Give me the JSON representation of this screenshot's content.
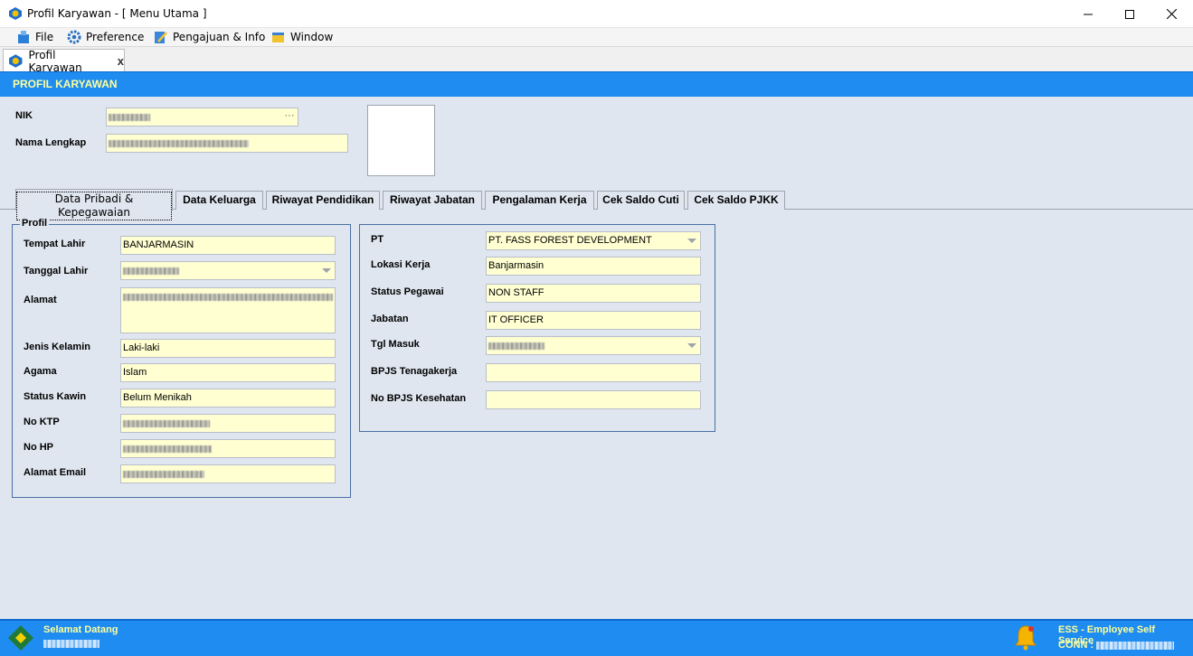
{
  "window": {
    "title": "Profil Karyawan - [ Menu Utama ]",
    "minimize_glyph": "—",
    "maximize_glyph": "☐",
    "close_glyph": "✕"
  },
  "menu": {
    "items": [
      {
        "label": "File",
        "icon": "file-icon"
      },
      {
        "label": "Preference",
        "icon": "gear-icon"
      },
      {
        "label": "Pengajuan & Info",
        "icon": "edit-document-icon"
      },
      {
        "label": "Window",
        "icon": "window-icon"
      }
    ]
  },
  "doc_tab": {
    "label": "Profil Karyawan",
    "close": "x"
  },
  "header": {
    "title": "PROFIL KARYAWAN"
  },
  "identity": {
    "nik_label": "NIK",
    "nik_value": "",
    "nik_browse": "···",
    "nama_label": "Nama Lengkap",
    "nama_value": ""
  },
  "subtabs": [
    "Data Pribadi & Kepegawaian",
    "Data Keluarga",
    "Riwayat Pendidikan",
    "Riwayat Jabatan",
    "Pengalaman Kerja",
    "Cek Saldo Cuti",
    "Cek Saldo PJKK"
  ],
  "profil": {
    "group_title": "Profil",
    "tempat_lahir": {
      "label": "Tempat Lahir",
      "value": "BANJARMASIN"
    },
    "tanggal_lahir": {
      "label": "Tanggal Lahir",
      "value": ""
    },
    "alamat": {
      "label": "Alamat",
      "value": ""
    },
    "jenis_kelamin": {
      "label": "Jenis Kelamin",
      "value": "Laki-laki"
    },
    "agama": {
      "label": "Agama",
      "value": "Islam"
    },
    "status_kawin": {
      "label": "Status Kawin",
      "value": "Belum Menikah"
    },
    "no_ktp": {
      "label": "No KTP",
      "value": ""
    },
    "no_hp": {
      "label": "No HP",
      "value": ""
    },
    "alamat_email": {
      "label": "Alamat Email",
      "value": ""
    }
  },
  "kepegawaian": {
    "pt": {
      "label": "PT",
      "value": "PT. FASS FOREST DEVELOPMENT"
    },
    "lokasi_kerja": {
      "label": "Lokasi Kerja",
      "value": "Banjarmasin"
    },
    "status_pegawai": {
      "label": "Status Pegawai",
      "value": "NON STAFF"
    },
    "jabatan": {
      "label": "Jabatan",
      "value": "IT OFFICER"
    },
    "tgl_masuk": {
      "label": "Tgl Masuk",
      "value": ""
    },
    "bpjs_tenagakerja": {
      "label": "BPJS Tenagakerja",
      "value": ""
    },
    "no_bpjs_kesehatan": {
      "label": "No BPJS Kesehatan",
      "value": ""
    }
  },
  "status": {
    "welcome": "Selamat Datang",
    "app_name": "ESS - Employee Self Service",
    "conn_label": "CONN :"
  },
  "colors": {
    "accent_blue": "#1e8cf0",
    "header_text": "#ffff9c",
    "panel_bg": "#dfe6ef",
    "field_bg": "#ffffd2"
  }
}
